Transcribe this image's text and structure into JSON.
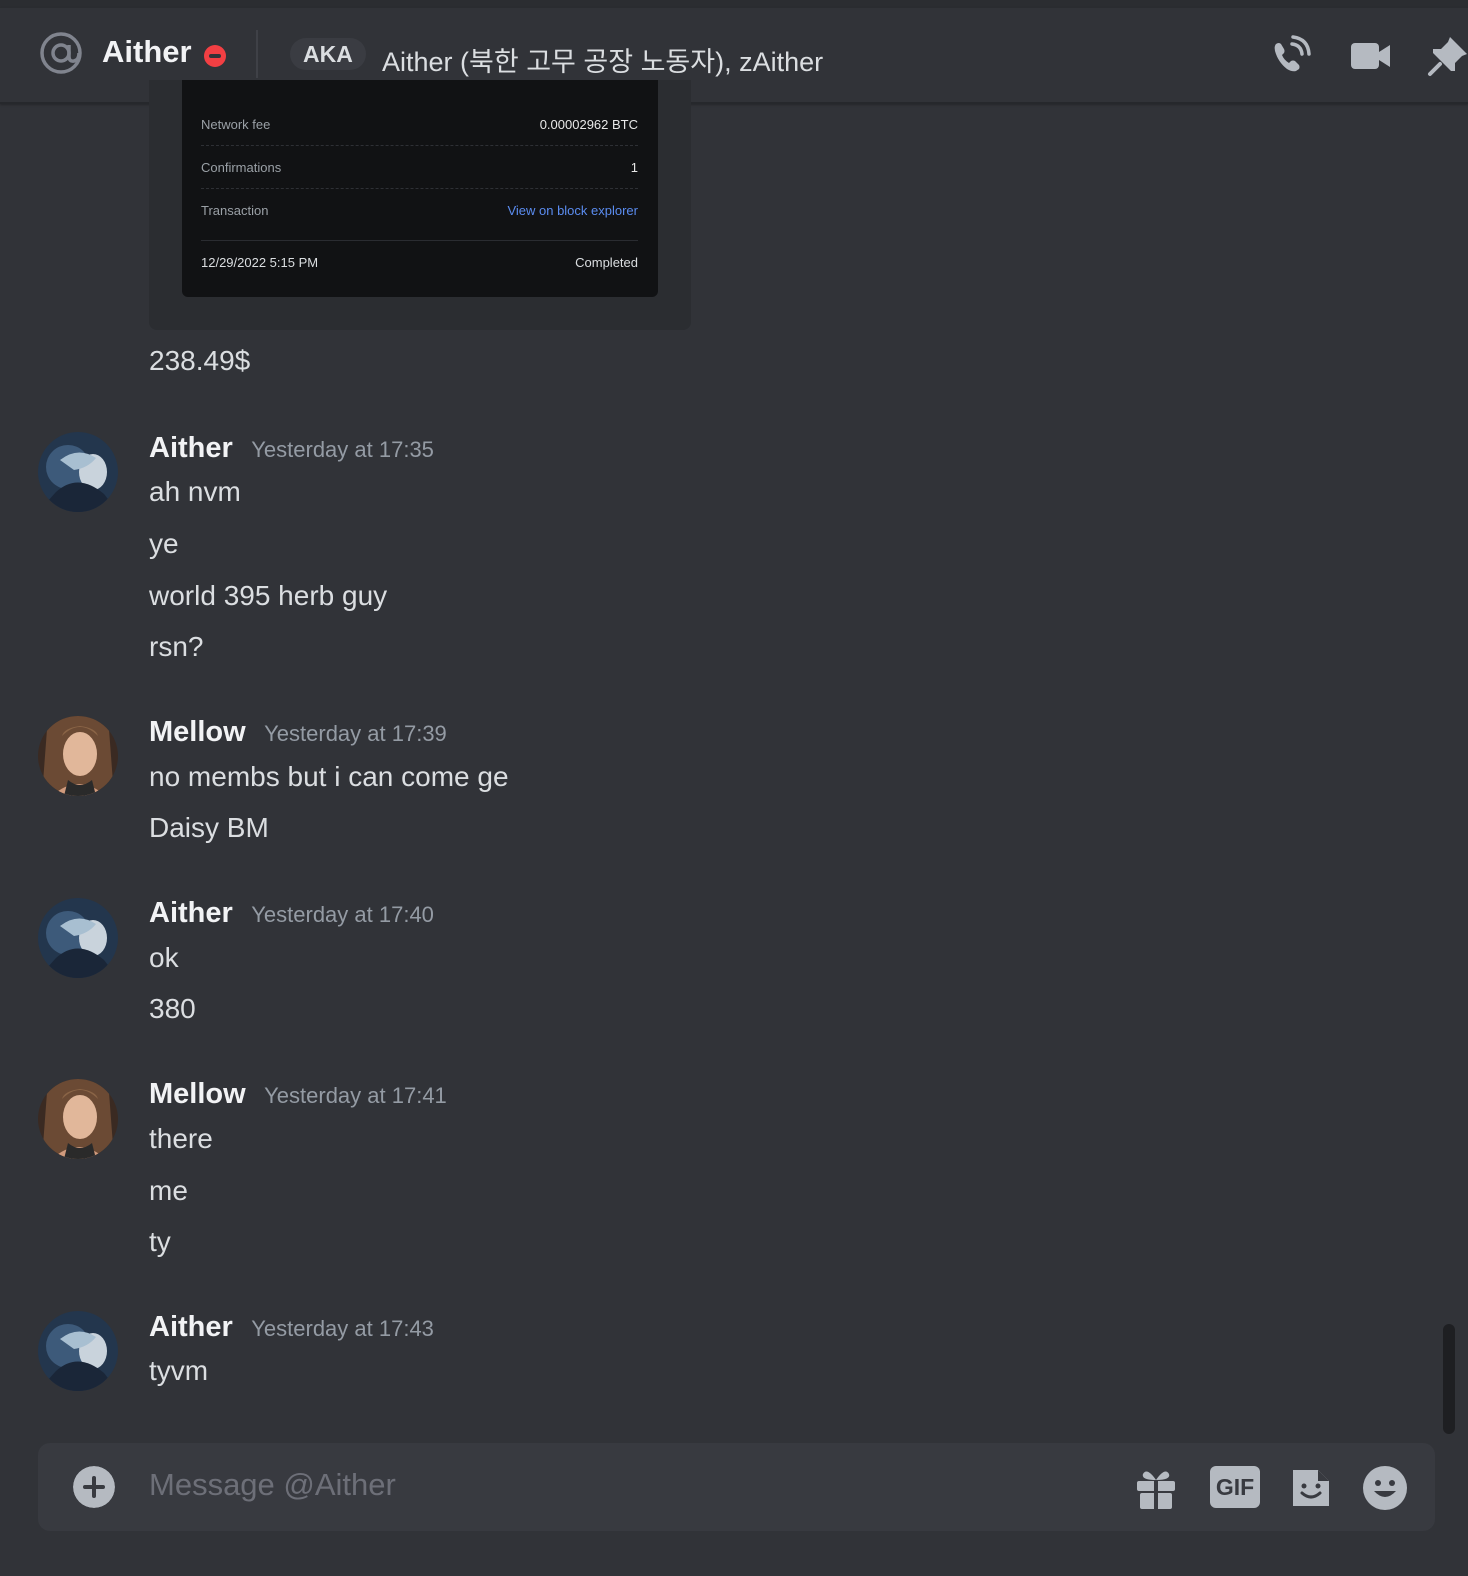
{
  "header": {
    "title": "Aither",
    "aka_label": "AKA",
    "aka_names": "Aither (북한 고무 공장 노동자), zAither",
    "icons": [
      "at-icon",
      "dnd-status-icon",
      "phone-call-icon",
      "video-call-icon",
      "pin-icon"
    ]
  },
  "embed": {
    "rows": [
      {
        "label": "Network fee",
        "value": "0.00002962 BTC"
      },
      {
        "label": "Confirmations",
        "value": "1"
      },
      {
        "label": "Transaction",
        "value": "View on block explorer"
      }
    ],
    "footer": {
      "date": "12/29/2022 5:15 PM",
      "status": "Completed"
    }
  },
  "standalone_message": "238.49$",
  "messages": [
    {
      "author": "Aither",
      "timestamp": "Yesterday at 17:35",
      "lines": [
        "ah nvm",
        "ye",
        "world 395 herb guy",
        "rsn?"
      ]
    },
    {
      "author": "Mellow",
      "timestamp": "Yesterday at 17:39",
      "lines": [
        "no membs but i can come ge",
        "Daisy BM"
      ]
    },
    {
      "author": "Aither",
      "timestamp": "Yesterday at 17:40",
      "lines": [
        "ok",
        "380"
      ]
    },
    {
      "author": "Mellow",
      "timestamp": "Yesterday at 17:41",
      "lines": [
        "there",
        "me",
        "ty"
      ]
    },
    {
      "author": "Aither",
      "timestamp": "Yesterday at 17:43",
      "lines": [
        "tyvm"
      ]
    }
  ],
  "composer": {
    "placeholder": "Message @Aither",
    "gif_label": "GIF",
    "icons": [
      "plus-circle-icon",
      "gift-icon",
      "gif-icon",
      "sticker-icon",
      "emoji-icon"
    ]
  },
  "colors": {
    "background": "#313338",
    "composer": "#383a40",
    "dnd_red": "#f23f43",
    "link_blue": "#5b8cf0"
  }
}
